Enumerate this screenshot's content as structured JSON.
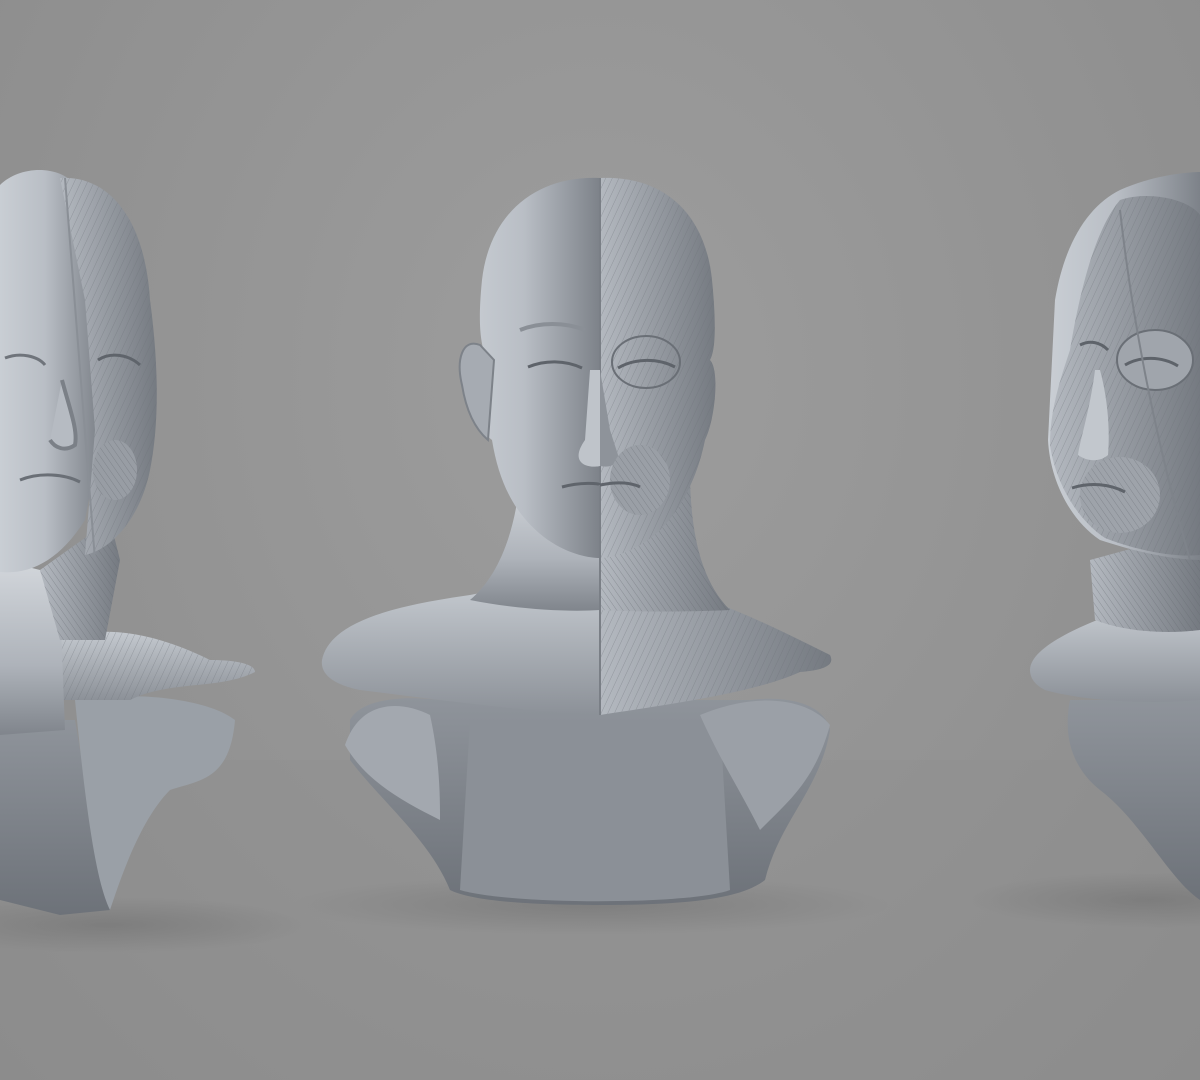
{
  "scene": {
    "subject": "ecorche-head-busts",
    "views": [
      {
        "name": "three-quarter-left",
        "variant": "half-skin-half-muscle"
      },
      {
        "name": "front",
        "variant": "half-skin-half-muscle"
      },
      {
        "name": "three-quarter-right",
        "variant": "muscle-face"
      }
    ]
  },
  "colors": {
    "background": "#959595",
    "floor": "#8f8f8f",
    "sculpt_light": "#d9dde2",
    "sculpt_mid": "#a6abb2",
    "sculpt_dark": "#5f646b"
  }
}
